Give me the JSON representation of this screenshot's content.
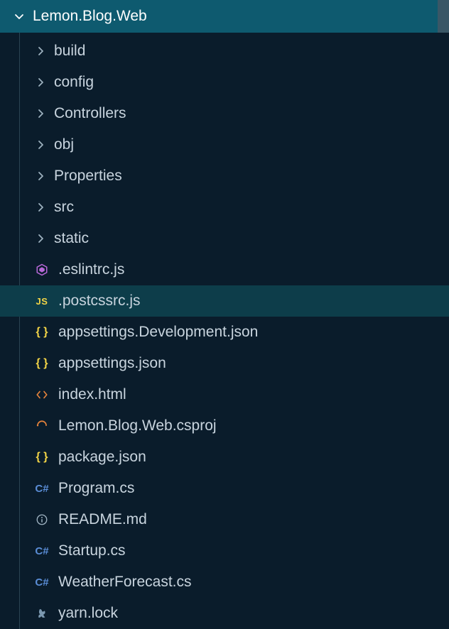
{
  "root": {
    "label": "Lemon.Blog.Web",
    "expanded": true
  },
  "items": [
    {
      "kind": "folder",
      "label": "build",
      "expanded": false
    },
    {
      "kind": "folder",
      "label": "config",
      "expanded": false
    },
    {
      "kind": "folder",
      "label": "Controllers",
      "expanded": false
    },
    {
      "kind": "folder",
      "label": "obj",
      "expanded": false
    },
    {
      "kind": "folder",
      "label": "Properties",
      "expanded": false
    },
    {
      "kind": "folder",
      "label": "src",
      "expanded": false
    },
    {
      "kind": "folder",
      "label": "static",
      "expanded": false
    },
    {
      "kind": "file",
      "label": ".eslintrc.js",
      "icon": "eslint"
    },
    {
      "kind": "file",
      "label": ".postcssrc.js",
      "icon": "js",
      "selected": true
    },
    {
      "kind": "file",
      "label": "appsettings.Development.json",
      "icon": "json"
    },
    {
      "kind": "file",
      "label": "appsettings.json",
      "icon": "json"
    },
    {
      "kind": "file",
      "label": "index.html",
      "icon": "html"
    },
    {
      "kind": "file",
      "label": "Lemon.Blog.Web.csproj",
      "icon": "csproj"
    },
    {
      "kind": "file",
      "label": "package.json",
      "icon": "json"
    },
    {
      "kind": "file",
      "label": "Program.cs",
      "icon": "cs"
    },
    {
      "kind": "file",
      "label": "README.md",
      "icon": "info"
    },
    {
      "kind": "file",
      "label": "Startup.cs",
      "icon": "cs"
    },
    {
      "kind": "file",
      "label": "WeatherForecast.cs",
      "icon": "cs"
    },
    {
      "kind": "file",
      "label": "yarn.lock",
      "icon": "lock"
    }
  ],
  "icons": {
    "js_text": "JS",
    "json_text": "{ }",
    "cs_text": "C#"
  }
}
